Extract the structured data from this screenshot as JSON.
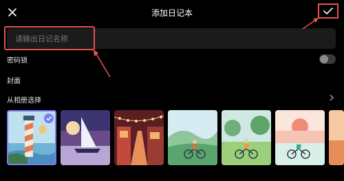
{
  "header": {
    "title": "添加日记本",
    "close_icon": "close-icon",
    "confirm_icon": "check-icon"
  },
  "name_field": {
    "placeholder": "请输出日记名称",
    "value": ""
  },
  "lock": {
    "label": "密码锁",
    "enabled": false
  },
  "cover": {
    "label": "封面"
  },
  "album": {
    "label": "从相册选择",
    "icon": "chevron-right-icon"
  },
  "covers": [
    {
      "name": "lighthouse",
      "selected": true
    },
    {
      "name": "sailboat",
      "selected": false
    },
    {
      "name": "street-lights",
      "selected": false
    },
    {
      "name": "cyclist-hills",
      "selected": false
    },
    {
      "name": "cyclist-park",
      "selected": false
    },
    {
      "name": "cyclist-sunset",
      "selected": false
    },
    {
      "name": "partial-cover",
      "selected": false
    }
  ],
  "colors": {
    "accent": "#7d7af2",
    "annotation": "#e5534b",
    "background": "#000000",
    "field": "#1b1b1b"
  }
}
